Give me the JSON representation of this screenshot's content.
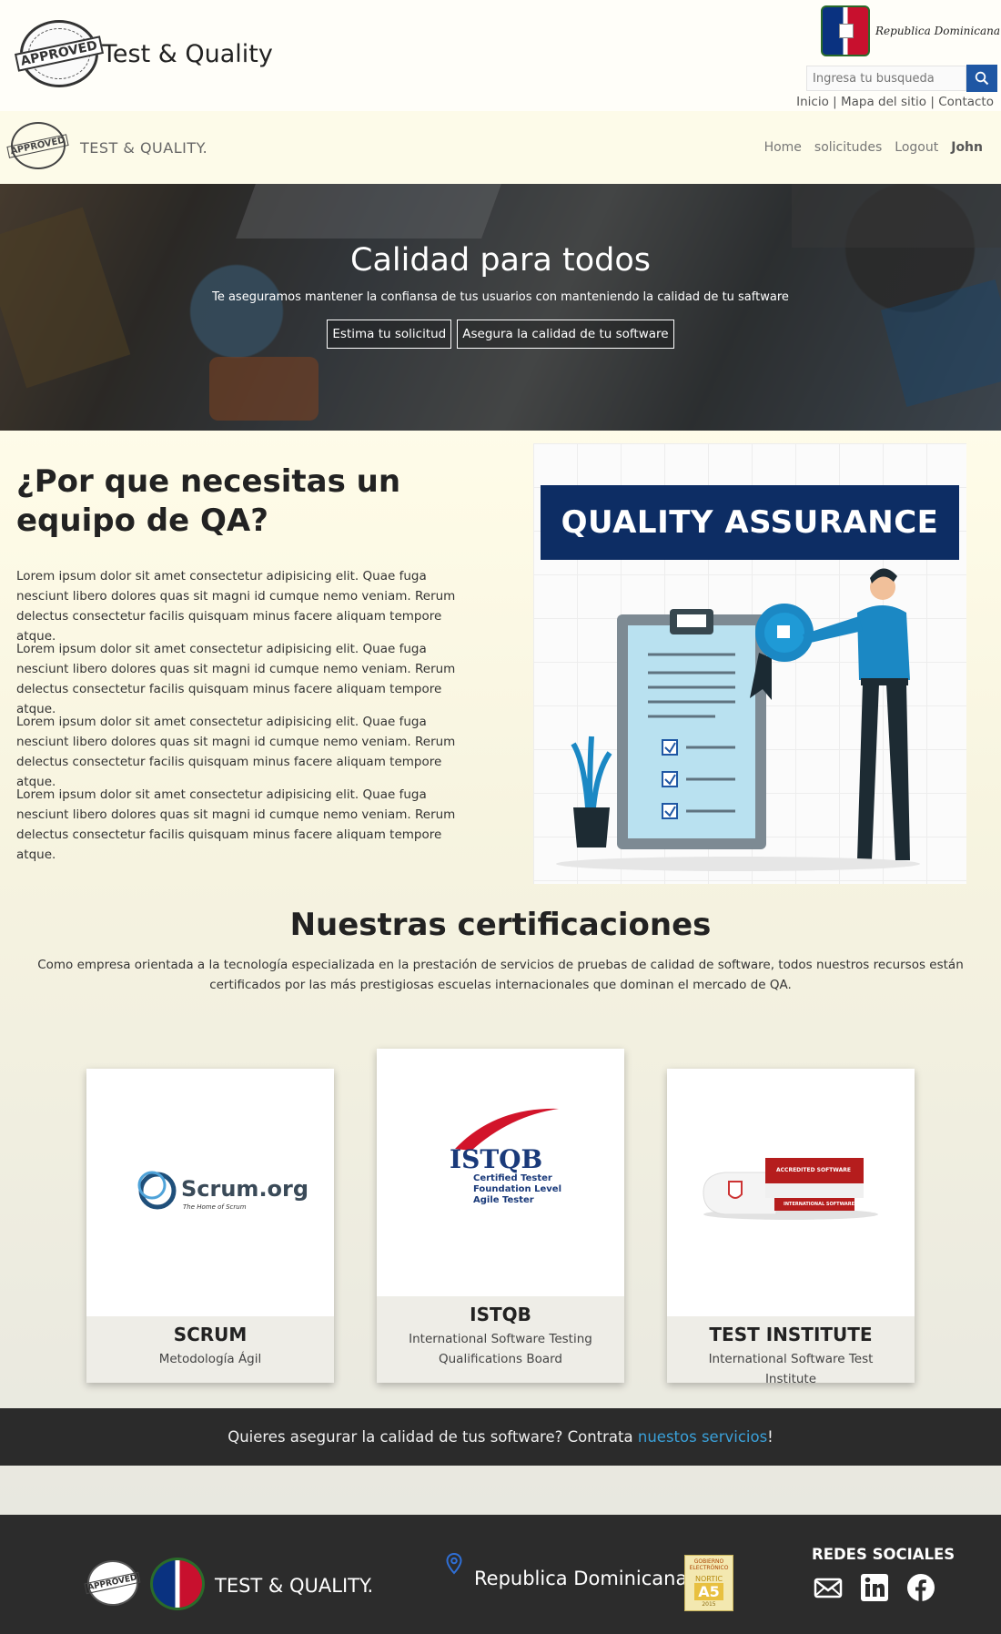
{
  "header": {
    "logo_text": "APPROVED",
    "title": "Test & Quality",
    "gov_name": "Republica Dominicana",
    "search_placeholder": "Ingresa tu busqueda",
    "links": [
      "Inicio",
      "Mapa del sitio",
      "Contacto"
    ]
  },
  "navbar": {
    "logo_text": "APPROVED",
    "brand": "TEST & QUALITY.",
    "items": [
      "Home",
      "solicitudes",
      "Logout"
    ],
    "user": "John"
  },
  "hero": {
    "title": "Calidad para todos",
    "subtitle": "Te aseguramos mantener la confiansa de tus usuarios con manteniendo la calidad de tu saftware",
    "buttons": [
      "Estima tu solicitud",
      "Asegura la calidad de tu software"
    ]
  },
  "qa": {
    "title": "¿Por que necesitas un equipo de QA?",
    "paragraphs": [
      "Lorem ipsum dolor sit amet consectetur adipisicing elit. Quae fuga nesciunt libero dolores quas sit magni id cumque nemo veniam. Rerum delectus consectetur facilis quisquam minus facere aliquam tempore atque.",
      "Lorem ipsum dolor sit amet consectetur adipisicing elit. Quae fuga nesciunt libero dolores quas sit magni id cumque nemo veniam. Rerum delectus consectetur facilis quisquam minus facere aliquam tempore atque.",
      "Lorem ipsum dolor sit amet consectetur adipisicing elit. Quae fuga nesciunt libero dolores quas sit magni id cumque nemo veniam. Rerum delectus consectetur facilis quisquam minus facere aliquam tempore atque.",
      "Lorem ipsum dolor sit amet consectetur adipisicing elit. Quae fuga nesciunt libero dolores quas sit magni id cumque nemo veniam. Rerum delectus consectetur facilis quisquam minus facere aliquam tempore atque."
    ],
    "image_banner": "QUALITY ASSURANCE"
  },
  "certifications": {
    "title": "Nuestras certificaciones",
    "subtitle": "Como empresa orientada a la tecnología especializada en la prestación de servicios de pruebas de calidad de software, todos nuestros recursos están certificados por las más prestigiosas escuelas internacionales que dominan el mercado de QA.",
    "cards": [
      {
        "title": "SCRUM",
        "text": "Metodología Ágil",
        "logo_main": "Scrum.org",
        "logo_sub": "The Home of Scrum"
      },
      {
        "title": "ISTQB",
        "text": "International Software Testing Qualifications Board",
        "logo_main": "ISTQB",
        "logo_sub1": "Certified Tester",
        "logo_sub2": "Foundation Level",
        "logo_sub3": "Agile Tester"
      },
      {
        "title": "TEST INSTITUTE",
        "text": "International Software Test Institute",
        "logo_main": "ACCREDITED SOFTWARE",
        "logo_sub": "INTERNATIONAL SOFTWARE"
      }
    ]
  },
  "cta": {
    "text": "Quieres asegurar la calidad de tus software? Contrata ",
    "link": "nuestos servicios",
    "end": "!"
  },
  "footer": {
    "logo_text": "APPROVED",
    "brand": "TEST & QUALITY.",
    "country": "Republica Dominicana",
    "nortic_top": "GOBIERNO ELECTRÓNICO",
    "nortic_mid": "NORTIC",
    "nortic_code": "A5",
    "nortic_year": "2015",
    "social_title": "REDES SOCIALES"
  },
  "colors": {
    "search_button": "#1f57a4",
    "qa_banner": "#0d2d64",
    "footer_bg": "#2c2c2c",
    "cta_link": "#3aa0d8"
  },
  "icons": [
    "search-icon",
    "map-pin-icon",
    "mail-icon",
    "linkedin-icon",
    "facebook-icon"
  ]
}
